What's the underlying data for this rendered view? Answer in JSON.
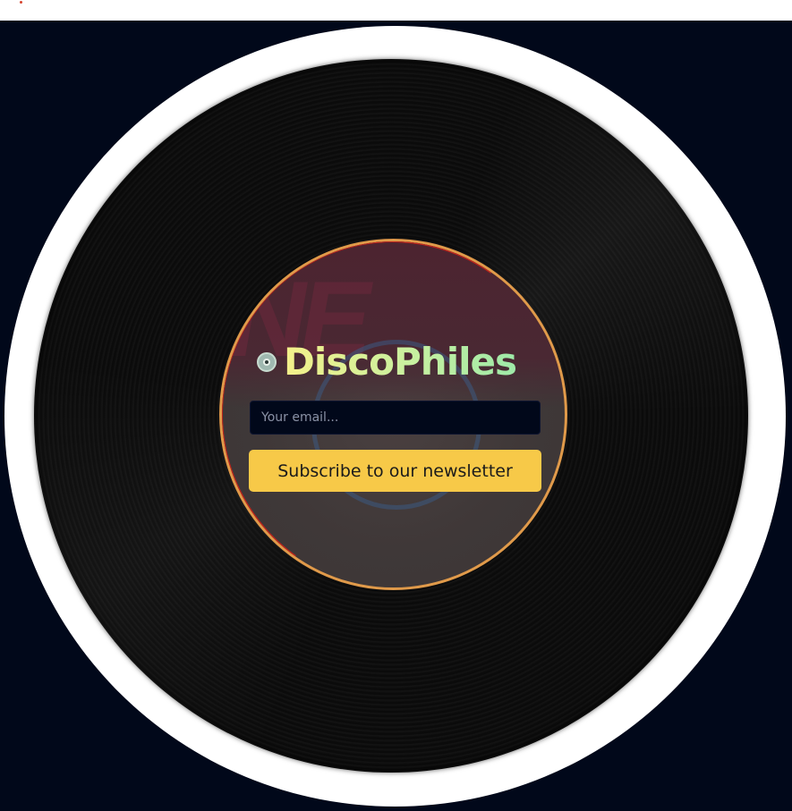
{
  "brand": {
    "name": "DiscoPhiles",
    "icon": "vinyl-disc-icon"
  },
  "newsletter": {
    "email_placeholder": "Your email...",
    "email_value": "",
    "subscribe_label": "Subscribe to our newsletter"
  },
  "colors": {
    "background": "#01081a",
    "rim": "#ffffff",
    "record": "#0d0d0d",
    "label_edge": "#e09a4a",
    "label_red_arc": "#c0231c",
    "title_gradient_start": "#f4f08a",
    "title_gradient_end": "#9ee9a8",
    "button": "#f7c948",
    "button_text": "#1b1b1b",
    "input_background": "#01081a"
  }
}
